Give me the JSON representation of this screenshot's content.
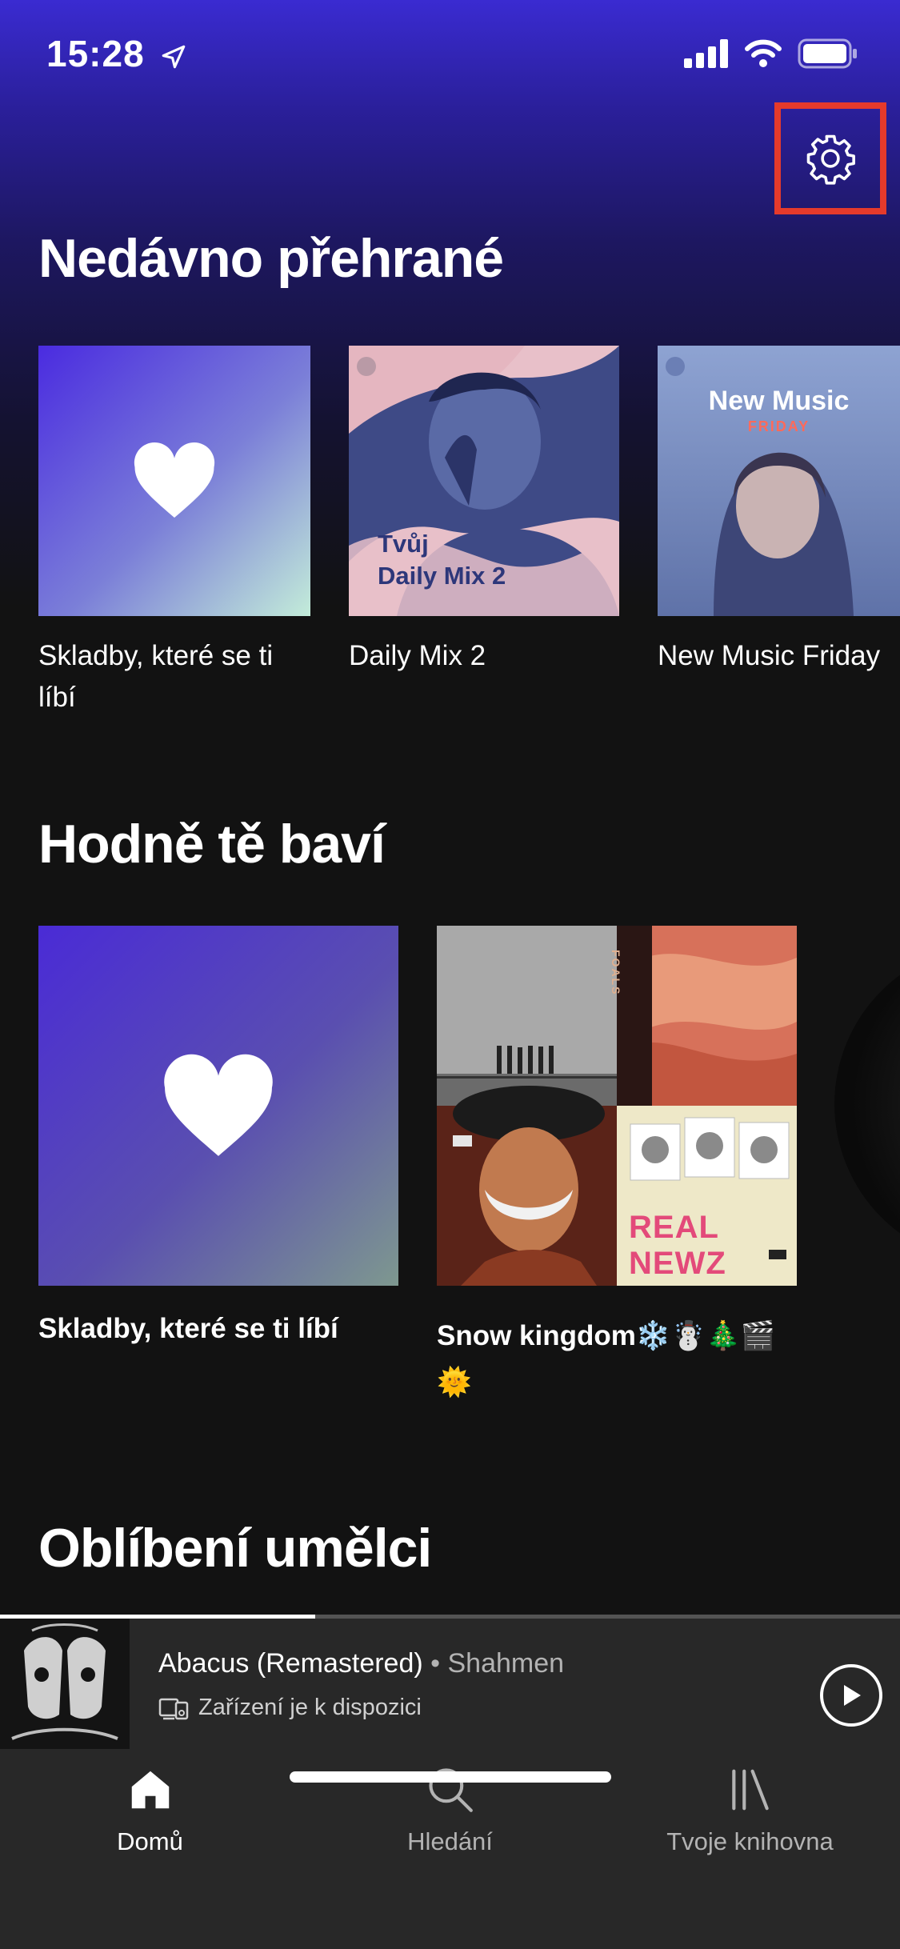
{
  "status_bar": {
    "time": "15:28"
  },
  "sections": {
    "recent": {
      "title": "Nedávno přehrané",
      "items": [
        {
          "label_line1": "Skladby, které se ti",
          "label_line2": "líbí"
        },
        {
          "label": "Daily Mix 2",
          "art_line1": "Tvůj",
          "art_line2": "Daily Mix 2"
        },
        {
          "label": "New Music Friday",
          "art_title": "New Music",
          "art_sub": "FRIDAY"
        }
      ]
    },
    "favorites": {
      "title": "Hodně tě baví",
      "items": [
        {
          "label": "Skladby, které se ti líbí"
        },
        {
          "label_line1": "Snow kingdom❄️☃️🎄🎬",
          "label_line2": "🌞",
          "tile_text_1": "FOALS",
          "tile_text_2": "REAL NEWZ"
        }
      ]
    },
    "artists": {
      "title": "Oblíbení umělci"
    }
  },
  "now_playing": {
    "track": "Abacus (Remastered)",
    "separator": " • ",
    "artist": "Shahmen",
    "device_text": "Zařízení je k dispozici",
    "progress": 0.35
  },
  "nav": {
    "home": "Domů",
    "search": "Hledání",
    "library": "Tvoje knihovna"
  },
  "colors": {
    "accent_highlight": "#e53a2b",
    "background": "#121212",
    "bar": "#282828"
  }
}
